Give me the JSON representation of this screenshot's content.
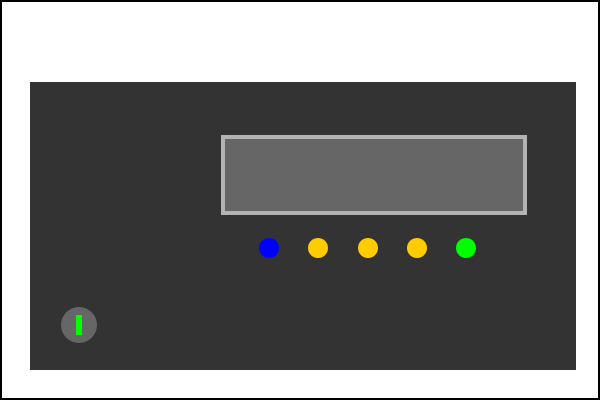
{
  "device": {
    "panel_color": "#333333",
    "display": {
      "text": "",
      "background_color": "#666666",
      "border_color": "#b3b3b3"
    },
    "indicator_lights": [
      {
        "name": "indicator-light-1",
        "color": "#0000ff"
      },
      {
        "name": "indicator-light-2",
        "color": "#ffcc00"
      },
      {
        "name": "indicator-light-3",
        "color": "#ffcc00"
      },
      {
        "name": "indicator-light-4",
        "color": "#ffcc00"
      },
      {
        "name": "indicator-light-5",
        "color": "#00ff00"
      }
    ],
    "power_button": {
      "icon": "power-icon",
      "button_color": "#666666",
      "icon_color": "#00ff00"
    }
  }
}
